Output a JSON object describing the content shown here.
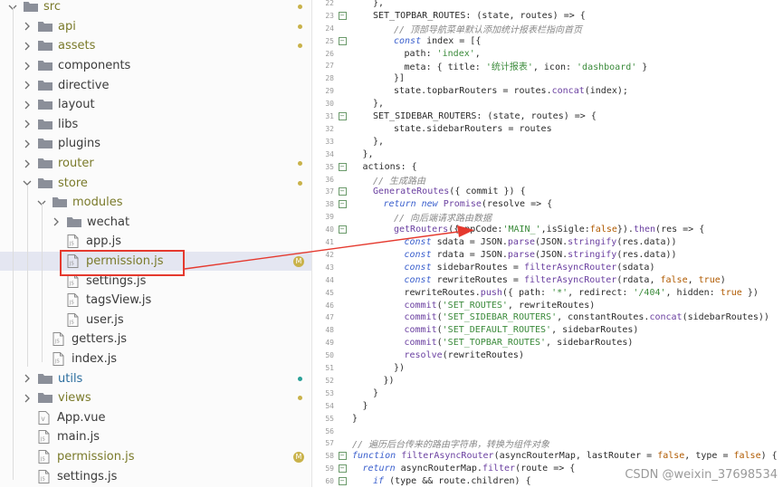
{
  "explorer": {
    "items": [
      {
        "label": "src",
        "kind": "folder",
        "expanded": true,
        "indent": 0,
        "status": "dot-olive",
        "color": "olive"
      },
      {
        "label": "api",
        "kind": "folder",
        "expanded": false,
        "indent": 1,
        "status": "dot-olive",
        "color": "olive"
      },
      {
        "label": "assets",
        "kind": "folder",
        "expanded": false,
        "indent": 1,
        "status": "dot-olive",
        "color": "olive"
      },
      {
        "label": "components",
        "kind": "folder",
        "expanded": false,
        "indent": 1,
        "status": "",
        "color": "plain"
      },
      {
        "label": "directive",
        "kind": "folder",
        "expanded": false,
        "indent": 1,
        "status": "",
        "color": "plain"
      },
      {
        "label": "layout",
        "kind": "folder",
        "expanded": false,
        "indent": 1,
        "status": "",
        "color": "plain"
      },
      {
        "label": "libs",
        "kind": "folder",
        "expanded": false,
        "indent": 1,
        "status": "",
        "color": "plain"
      },
      {
        "label": "plugins",
        "kind": "folder",
        "expanded": false,
        "indent": 1,
        "status": "",
        "color": "plain"
      },
      {
        "label": "router",
        "kind": "folder",
        "expanded": false,
        "indent": 1,
        "status": "dot-olive",
        "color": "olive"
      },
      {
        "label": "store",
        "kind": "folder",
        "expanded": true,
        "indent": 1,
        "status": "dot-olive",
        "color": "olive"
      },
      {
        "label": "modules",
        "kind": "folder",
        "expanded": true,
        "indent": 2,
        "status": "",
        "color": "olive"
      },
      {
        "label": "wechat",
        "kind": "folder",
        "expanded": false,
        "indent": 3,
        "status": "",
        "color": "plain"
      },
      {
        "label": "app.js",
        "kind": "file",
        "indent": 3,
        "status": "",
        "color": "plain"
      },
      {
        "label": "permission.js",
        "kind": "file",
        "indent": 3,
        "status": "M",
        "color": "olive",
        "selected": true
      },
      {
        "label": "settings.js",
        "kind": "file",
        "indent": 3,
        "status": "",
        "color": "plain"
      },
      {
        "label": "tagsView.js",
        "kind": "file",
        "indent": 3,
        "status": "",
        "color": "plain"
      },
      {
        "label": "user.js",
        "kind": "file",
        "indent": 3,
        "status": "",
        "color": "plain"
      },
      {
        "label": "getters.js",
        "kind": "file",
        "indent": 2,
        "status": "",
        "color": "plain"
      },
      {
        "label": "index.js",
        "kind": "file",
        "indent": 2,
        "status": "",
        "color": "plain"
      },
      {
        "label": "utils",
        "kind": "folder",
        "expanded": false,
        "indent": 1,
        "status": "dot-teal",
        "color": "blue"
      },
      {
        "label": "views",
        "kind": "folder",
        "expanded": false,
        "indent": 1,
        "status": "dot-olive",
        "color": "olive"
      },
      {
        "label": "App.vue",
        "kind": "vue",
        "indent": 1,
        "status": "",
        "color": "plain"
      },
      {
        "label": "main.js",
        "kind": "file",
        "indent": 1,
        "status": "",
        "color": "plain"
      },
      {
        "label": "permission.js",
        "kind": "file",
        "indent": 1,
        "status": "M",
        "color": "olive"
      },
      {
        "label": "settings.js",
        "kind": "file",
        "indent": 1,
        "status": "",
        "color": "plain"
      }
    ],
    "badge_m": "M"
  },
  "editor": {
    "lines": [
      {
        "n": "22",
        "fold": false,
        "indent": 2,
        "t": [
          [
            "plain",
            "},"
          ]
        ]
      },
      {
        "n": "23",
        "fold": true,
        "indent": 2,
        "t": [
          [
            "plain",
            "SET_TOPBAR_ROUTES: (state, routes) => {"
          ]
        ]
      },
      {
        "n": "24",
        "fold": false,
        "indent": 4,
        "t": [
          [
            "cm",
            "// 顶部导航菜单默认添加统计报表栏指向首页"
          ]
        ]
      },
      {
        "n": "25",
        "fold": true,
        "indent": 4,
        "t": [
          [
            "kw",
            "const"
          ],
          [
            "plain",
            " index = [{"
          ]
        ]
      },
      {
        "n": "26",
        "fold": false,
        "indent": 5,
        "t": [
          [
            "plain",
            "path: "
          ],
          [
            "str",
            "'index'"
          ],
          [
            "plain",
            ","
          ]
        ]
      },
      {
        "n": "27",
        "fold": false,
        "indent": 5,
        "t": [
          [
            "plain",
            "meta: { title: "
          ],
          [
            "str",
            "'统计报表'"
          ],
          [
            "plain",
            ", icon: "
          ],
          [
            "str",
            "'dashboard'"
          ],
          [
            "plain",
            " }"
          ]
        ]
      },
      {
        "n": "28",
        "fold": false,
        "indent": 4,
        "t": [
          [
            "plain",
            "}]"
          ]
        ]
      },
      {
        "n": "29",
        "fold": false,
        "indent": 4,
        "t": [
          [
            "plain",
            "state.topbarRouters = routes."
          ],
          [
            "fn",
            "concat"
          ],
          [
            "plain",
            "(index);"
          ]
        ]
      },
      {
        "n": "30",
        "fold": false,
        "indent": 2,
        "t": [
          [
            "plain",
            "},"
          ]
        ]
      },
      {
        "n": "31",
        "fold": true,
        "indent": 2,
        "t": [
          [
            "plain",
            "SET_SIDEBAR_ROUTERS: (state, routes) => {"
          ]
        ]
      },
      {
        "n": "32",
        "fold": false,
        "indent": 4,
        "t": [
          [
            "plain",
            "state.sidebarRouters = routes"
          ]
        ]
      },
      {
        "n": "33",
        "fold": false,
        "indent": 2,
        "t": [
          [
            "plain",
            "},"
          ]
        ]
      },
      {
        "n": "34",
        "fold": false,
        "indent": 1,
        "t": [
          [
            "plain",
            "},"
          ]
        ]
      },
      {
        "n": "35",
        "fold": true,
        "indent": 1,
        "t": [
          [
            "plain",
            "actions: {"
          ]
        ]
      },
      {
        "n": "36",
        "fold": false,
        "indent": 2,
        "t": [
          [
            "cm",
            "// 生成路由"
          ]
        ]
      },
      {
        "n": "37",
        "fold": true,
        "indent": 2,
        "t": [
          [
            "fn",
            "GenerateRoutes"
          ],
          [
            "plain",
            "({ commit }) {"
          ]
        ]
      },
      {
        "n": "38",
        "fold": true,
        "indent": 3,
        "t": [
          [
            "kw",
            "return new"
          ],
          [
            "plain",
            " "
          ],
          [
            "fn",
            "Promise"
          ],
          [
            "plain",
            "(resolve => {"
          ]
        ]
      },
      {
        "n": "39",
        "fold": false,
        "indent": 4,
        "t": [
          [
            "cm",
            "// 向后端请求路由数据"
          ]
        ]
      },
      {
        "n": "40",
        "fold": true,
        "indent": 4,
        "t": [
          [
            "fn",
            "getRouters"
          ],
          [
            "plain",
            "({appCode:"
          ],
          [
            "str",
            "'MAIN_'"
          ],
          [
            "plain",
            ",isSigle:"
          ],
          [
            "const",
            "false"
          ],
          [
            "plain",
            "})."
          ],
          [
            "fn",
            "then"
          ],
          [
            "plain",
            "(res => {"
          ]
        ]
      },
      {
        "n": "41",
        "fold": false,
        "indent": 5,
        "t": [
          [
            "kw",
            "const"
          ],
          [
            "plain",
            " sdata = JSON."
          ],
          [
            "fn",
            "parse"
          ],
          [
            "plain",
            "(JSON."
          ],
          [
            "fn",
            "stringify"
          ],
          [
            "plain",
            "(res.data))"
          ]
        ]
      },
      {
        "n": "42",
        "fold": false,
        "indent": 5,
        "t": [
          [
            "kw",
            "const"
          ],
          [
            "plain",
            " rdata = JSON."
          ],
          [
            "fn",
            "parse"
          ],
          [
            "plain",
            "(JSON."
          ],
          [
            "fn",
            "stringify"
          ],
          [
            "plain",
            "(res.data))"
          ]
        ]
      },
      {
        "n": "43",
        "fold": false,
        "indent": 5,
        "t": [
          [
            "kw",
            "const"
          ],
          [
            "plain",
            " sidebarRoutes = "
          ],
          [
            "fn",
            "filterAsyncRouter"
          ],
          [
            "plain",
            "(sdata)"
          ]
        ]
      },
      {
        "n": "44",
        "fold": false,
        "indent": 5,
        "t": [
          [
            "kw",
            "const"
          ],
          [
            "plain",
            " rewriteRoutes = "
          ],
          [
            "fn",
            "filterAsyncRouter"
          ],
          [
            "plain",
            "(rdata, "
          ],
          [
            "const",
            "false"
          ],
          [
            "plain",
            ", "
          ],
          [
            "const",
            "true"
          ],
          [
            "plain",
            ")"
          ]
        ]
      },
      {
        "n": "45",
        "fold": false,
        "indent": 5,
        "t": [
          [
            "plain",
            "rewriteRoutes."
          ],
          [
            "fn",
            "push"
          ],
          [
            "plain",
            "({ path: "
          ],
          [
            "str",
            "'*'"
          ],
          [
            "plain",
            ", redirect: "
          ],
          [
            "str",
            "'/404'"
          ],
          [
            "plain",
            ", hidden: "
          ],
          [
            "const",
            "true"
          ],
          [
            "plain",
            " })"
          ]
        ]
      },
      {
        "n": "46",
        "fold": false,
        "indent": 5,
        "t": [
          [
            "fn",
            "commit"
          ],
          [
            "plain",
            "("
          ],
          [
            "str",
            "'SET_ROUTES'"
          ],
          [
            "plain",
            ", rewriteRoutes)"
          ]
        ]
      },
      {
        "n": "47",
        "fold": false,
        "indent": 5,
        "t": [
          [
            "fn",
            "commit"
          ],
          [
            "plain",
            "("
          ],
          [
            "str",
            "'SET_SIDEBAR_ROUTERS'"
          ],
          [
            "plain",
            ", constantRoutes."
          ],
          [
            "fn",
            "concat"
          ],
          [
            "plain",
            "(sidebarRoutes))"
          ]
        ]
      },
      {
        "n": "48",
        "fold": false,
        "indent": 5,
        "t": [
          [
            "fn",
            "commit"
          ],
          [
            "plain",
            "("
          ],
          [
            "str",
            "'SET_DEFAULT_ROUTES'"
          ],
          [
            "plain",
            ", sidebarRoutes)"
          ]
        ]
      },
      {
        "n": "49",
        "fold": false,
        "indent": 5,
        "t": [
          [
            "fn",
            "commit"
          ],
          [
            "plain",
            "("
          ],
          [
            "str",
            "'SET_TOPBAR_ROUTES'"
          ],
          [
            "plain",
            ", sidebarRoutes)"
          ]
        ]
      },
      {
        "n": "50",
        "fold": false,
        "indent": 5,
        "t": [
          [
            "fn",
            "resolve"
          ],
          [
            "plain",
            "(rewriteRoutes)"
          ]
        ]
      },
      {
        "n": "51",
        "fold": false,
        "indent": 4,
        "t": [
          [
            "plain",
            "})"
          ]
        ]
      },
      {
        "n": "52",
        "fold": false,
        "indent": 3,
        "t": [
          [
            "plain",
            "})"
          ]
        ]
      },
      {
        "n": "53",
        "fold": false,
        "indent": 2,
        "t": [
          [
            "plain",
            "}"
          ]
        ]
      },
      {
        "n": "54",
        "fold": false,
        "indent": 1,
        "t": [
          [
            "plain",
            "}"
          ]
        ]
      },
      {
        "n": "55",
        "fold": false,
        "indent": 0,
        "t": [
          [
            "plain",
            "}"
          ]
        ]
      },
      {
        "n": "56",
        "fold": false,
        "indent": 0,
        "t": []
      },
      {
        "n": "57",
        "fold": false,
        "indent": 0,
        "t": [
          [
            "cm",
            "// 遍历后台传来的路由字符串，转换为组件对象"
          ]
        ]
      },
      {
        "n": "58",
        "fold": true,
        "indent": 0,
        "t": [
          [
            "kw",
            "function"
          ],
          [
            "plain",
            " "
          ],
          [
            "fn",
            "filterAsyncRouter"
          ],
          [
            "plain",
            "(asyncRouterMap, lastRouter = "
          ],
          [
            "const",
            "false"
          ],
          [
            "plain",
            ", type = "
          ],
          [
            "const",
            "false"
          ],
          [
            "plain",
            ") {"
          ]
        ]
      },
      {
        "n": "59",
        "fold": true,
        "indent": 1,
        "t": [
          [
            "kw",
            "return"
          ],
          [
            "plain",
            " asyncRouterMap."
          ],
          [
            "fn",
            "filter"
          ],
          [
            "plain",
            "(route => {"
          ]
        ]
      },
      {
        "n": "60",
        "fold": true,
        "indent": 2,
        "t": [
          [
            "kw",
            "if"
          ],
          [
            "plain",
            " (type && route.children) {"
          ]
        ]
      }
    ]
  },
  "watermark": "CSDN @weixin_37698534",
  "colors": {
    "highlight": "#e5392e",
    "arrow": "#e5392e"
  }
}
